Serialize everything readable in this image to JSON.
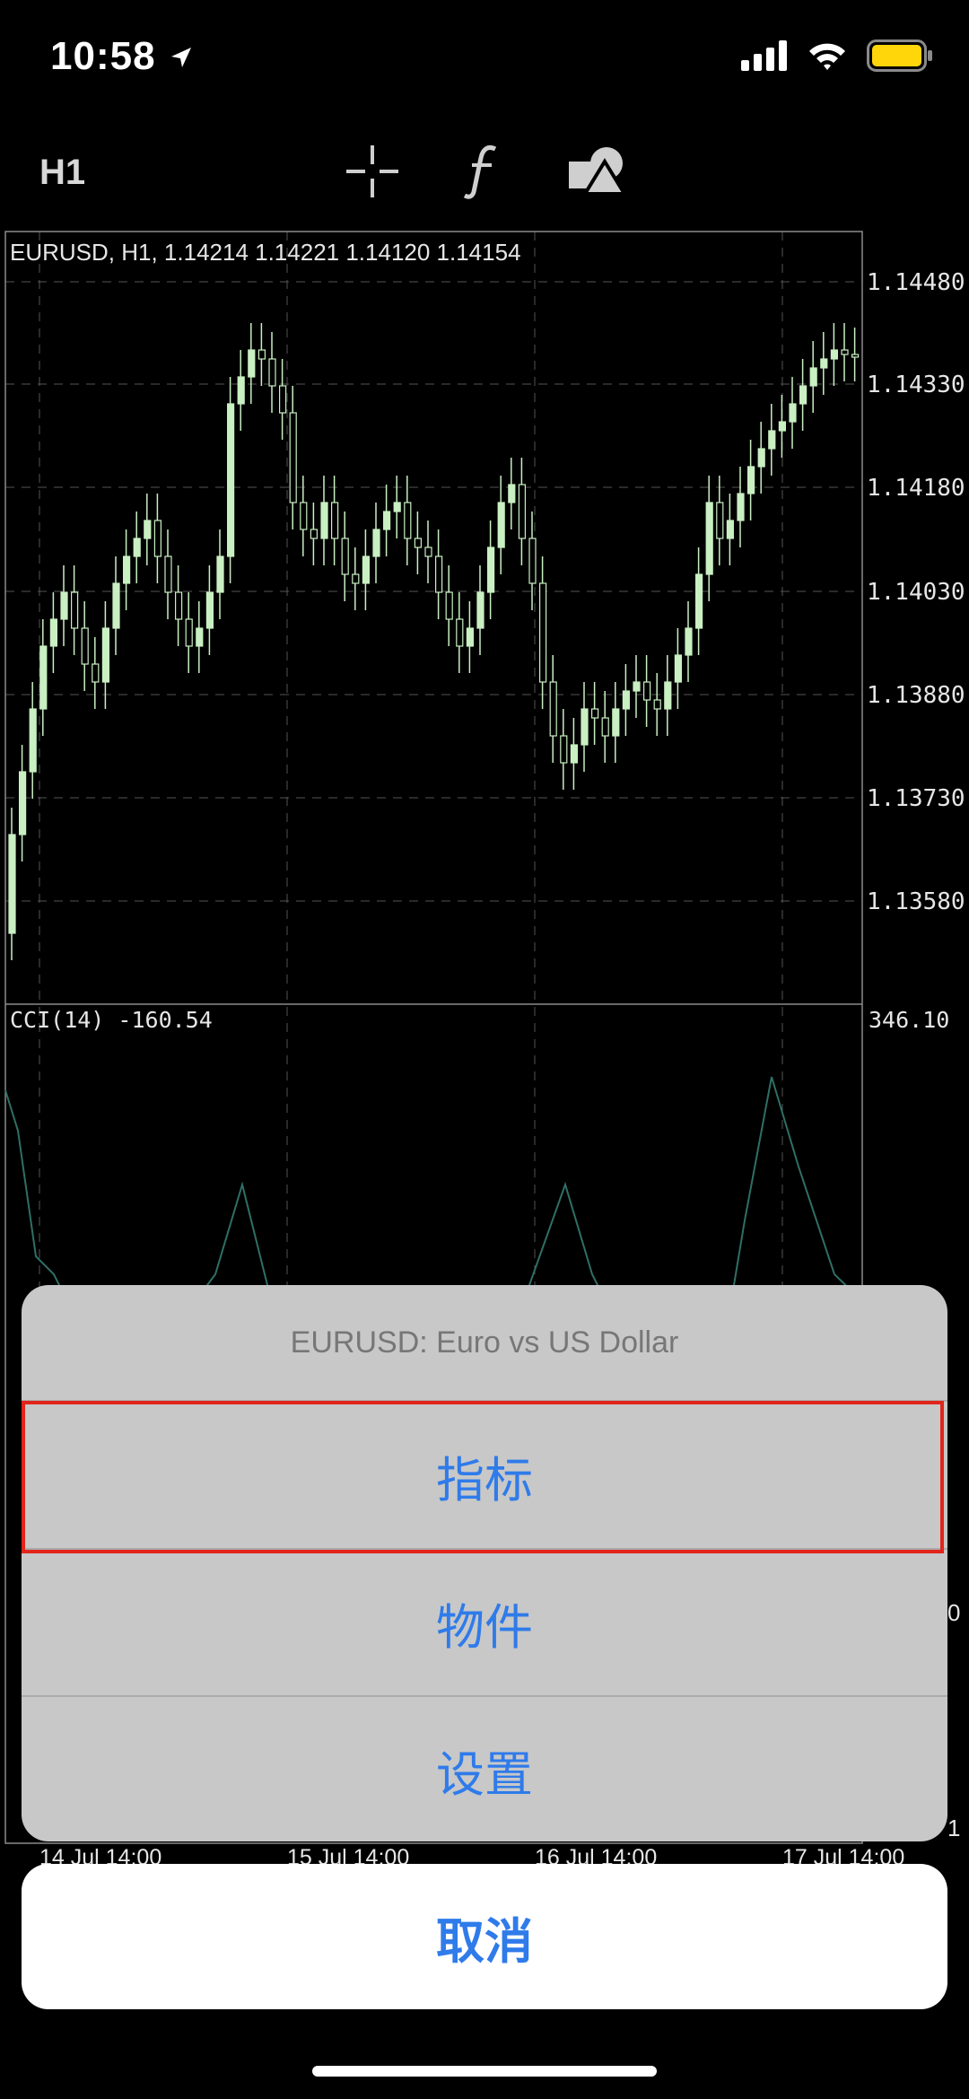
{
  "status": {
    "time": "10:58",
    "battery_color": "#ffd60a"
  },
  "toolbar": {
    "timeframe": "H1",
    "icons": [
      "crosshair-icon",
      "function-icon",
      "objects-icon"
    ]
  },
  "chart": {
    "info": "EURUSD, H1, 1.14214 1.14221 1.14120 1.14154",
    "price_labels": [
      "1.14480",
      "1.14330",
      "1.14180",
      "1.14030",
      "1.13880",
      "1.13730",
      "1.13580"
    ],
    "cci_info": "CCI(14) -160.54",
    "cci_max": "346.10",
    "x_labels": [
      "14 Jul 14:00",
      "15 Jul 14:00",
      "16 Jul 14:00",
      "17 Jul 14:00"
    ],
    "right_edge_values": [
      "0",
      "1"
    ]
  },
  "sheet": {
    "title": "EURUSD: Euro vs US Dollar",
    "items": [
      "指标",
      "物件",
      "设置"
    ],
    "cancel": "取消"
  },
  "colors": {
    "accent": "#2f7bea",
    "highlight": "#e1251b",
    "candle": "#c9efc2",
    "cci_line": "#2f6f66"
  }
}
